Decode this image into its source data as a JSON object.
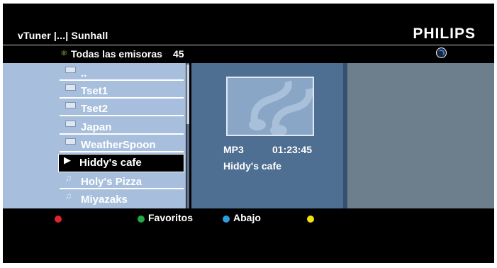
{
  "header": {
    "title": "vTuner |...| Sunhall",
    "brand": "PHILIPS"
  },
  "subheader": {
    "icon": "globe-icon",
    "label": "Todas las emisoras",
    "count": "45",
    "status_icon": "loading-spinner-icon"
  },
  "list": {
    "items": [
      {
        "label": "..",
        "icon": "folder-icon",
        "selected": false
      },
      {
        "label": "Tset1",
        "icon": "folder-icon",
        "selected": false
      },
      {
        "label": "Tset2",
        "icon": "folder-icon",
        "selected": false
      },
      {
        "label": "Japan",
        "icon": "folder-icon",
        "selected": false
      },
      {
        "label": "WeatherSpoon",
        "icon": "folder-icon",
        "selected": false
      },
      {
        "label": "Hiddy's cafe",
        "icon": "play-icon",
        "selected": true
      },
      {
        "label": "Holy's Pizza",
        "icon": "music-note-icon",
        "selected": false
      },
      {
        "label": "Miyazaks",
        "icon": "music-note-icon",
        "selected": false
      }
    ]
  },
  "details": {
    "format": "MP3",
    "duration": "01:23:45",
    "station": "Hiddy's cafe",
    "art_icon": "album-art-icon"
  },
  "footer": {
    "buttons": [
      {
        "color": "#e0242b",
        "label": ""
      },
      {
        "color": "#22a846",
        "label": "Favoritos"
      },
      {
        "color": "#2a9ee0",
        "label": "Abajo"
      },
      {
        "color": "#f2e20a",
        "label": ""
      }
    ]
  }
}
